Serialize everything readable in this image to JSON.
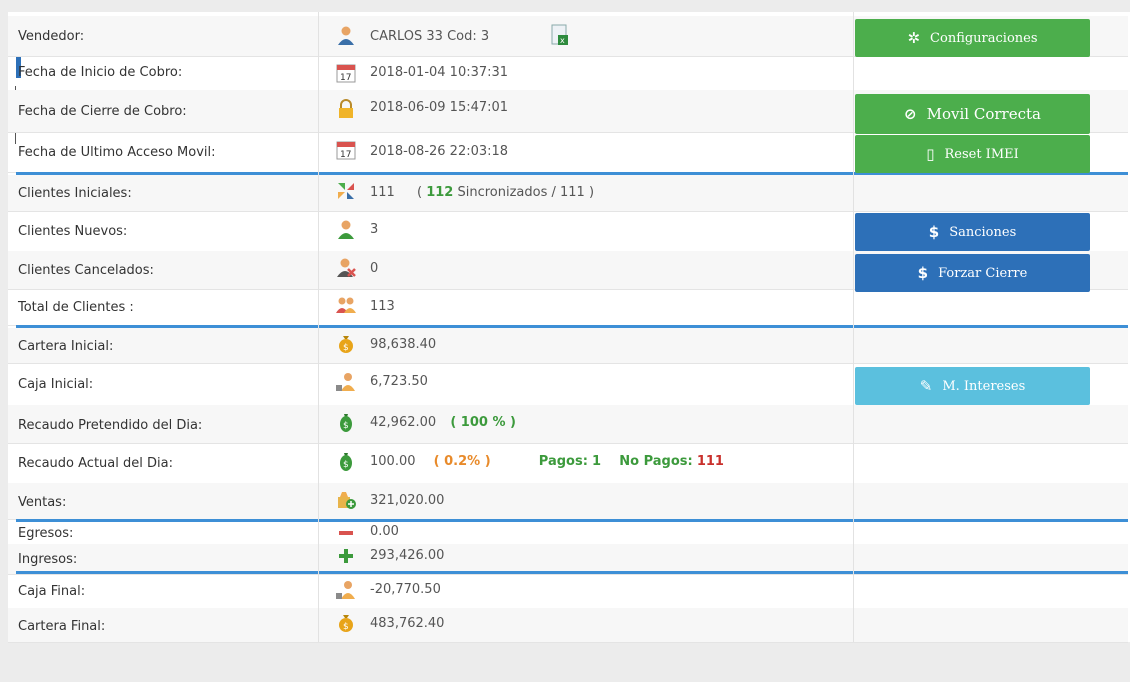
{
  "rows": [
    {
      "label": "Vendedor:",
      "icon": "user-icon",
      "value": "CARLOS 33  Cod: 3"
    },
    {
      "label": "Fecha de Inicio de Cobro:",
      "icon": "calendar-icon",
      "value": "2018-01-04 10:37:31"
    },
    {
      "label": "Fecha de Cierre de Cobro:",
      "icon": "lock-icon",
      "value": "2018-06-09 15:47:01"
    },
    {
      "label": "Fecha de Ultimo Acceso Movil:",
      "icon": "calendar-icon",
      "value": "2018-08-26 22:03:18"
    },
    {
      "label": "Clientes Iniciales:",
      "icon": "sync-icon",
      "value": "111",
      "sync_open": "(",
      "sync_count": "112",
      "sync_text": "Sincronizados / 111 )"
    },
    {
      "label": "Clientes Nuevos:",
      "icon": "user-icon",
      "value": "3"
    },
    {
      "label": "Clientes Cancelados:",
      "icon": "user-remove-icon",
      "value": "0"
    },
    {
      "label": "Total de Clientes :",
      "icon": "users-icon",
      "value": "113"
    },
    {
      "label": "Cartera Inicial:",
      "icon": "money-bag-icon",
      "value": "98,638.40"
    },
    {
      "label": "Caja Inicial:",
      "icon": "cash-user-icon",
      "value": "6,723.50"
    },
    {
      "label": "Recaudo Pretendido del Dia:",
      "icon": "money-icon",
      "value": "42,962.00",
      "percent": "( 100 % )"
    },
    {
      "label": "Recaudo Actual del Dia:",
      "icon": "money-icon",
      "value": "100.00",
      "percent": "( 0.2% )",
      "pagos_label": "Pagos:",
      "pagos": "1",
      "nopagos_label": "No Pagos:",
      "nopagos": "111"
    },
    {
      "label": "Ventas:",
      "icon": "sales-icon",
      "value": "321,020.00"
    },
    {
      "label": "Egresos:",
      "icon": "minus-icon",
      "value": "0.00"
    },
    {
      "label": "Ingresos:",
      "icon": "plus-icon",
      "value": "293,426.00"
    },
    {
      "label": "Caja Final:",
      "icon": "cash-user-icon",
      "value": "-20,770.50"
    },
    {
      "label": "Cartera Final:",
      "icon": "money-bag-icon",
      "value": "483,762.40"
    }
  ],
  "buttons": {
    "config": "Configuraciones",
    "movil": "Movil   Correcta",
    "reset": "Reset   IMEI",
    "sanciones": "Sanciones",
    "forzar": "Forzar   Cierre",
    "intereses": "M.   Intereses"
  },
  "colors": {
    "green": "#4cae4c",
    "blue": "#2d70b8",
    "light_blue": "#5bc0de",
    "separator": "#3d8fd6"
  }
}
